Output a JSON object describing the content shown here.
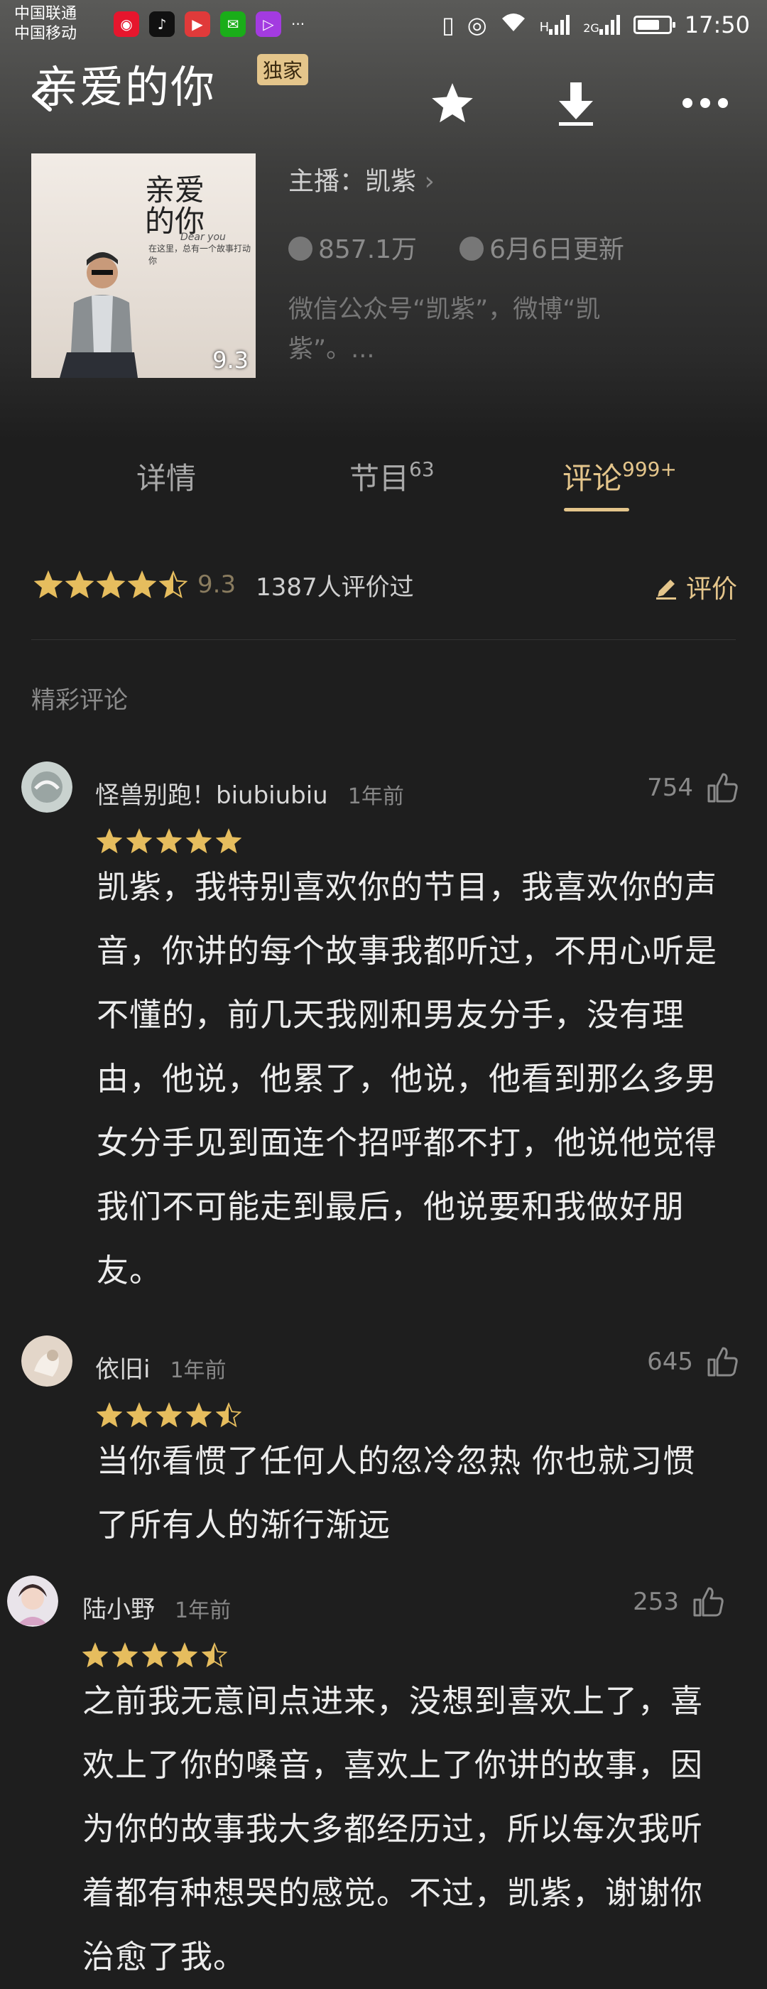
{
  "status_bar": {
    "carrier1": "中国联通",
    "carrier2": "中国移动",
    "signal1": "H",
    "signal2": "2G",
    "more": "···",
    "time": "17:50",
    "battery_level": 0.72
  },
  "header": {
    "title": "亲爱的你",
    "badge": "独家"
  },
  "album": {
    "cover_title": "亲爱的你",
    "cover_subtitle": "在这里，总有一个故事打动你",
    "cover_en": "Dear you",
    "cover_score": "9.3",
    "host_label": "主播：凯紫",
    "plays": "857.1万",
    "updated": "6月6日更新",
    "description": "微信公众号“凯紫”，微博“凯紫”。..."
  },
  "tabs": [
    {
      "label": "详情",
      "count": ""
    },
    {
      "label": "节目",
      "count": "63"
    },
    {
      "label": "评论",
      "count": "999+"
    }
  ],
  "rating": {
    "stars": 4.5,
    "score": "9.3",
    "count_text": "1387人评价过",
    "review_label": "评价"
  },
  "section_title": "精彩评论",
  "comments": [
    {
      "user": "怪兽别跑！biubiubiu",
      "time": "1年前",
      "likes": "754",
      "stars": 5,
      "text": "凯紫，我特别喜欢你的节目，我喜欢你的声音，你讲的每个故事我都听过，不用心听是不懂的，前几天我刚和男友分手，没有理由，他说，他累了，他说，他看到那么多男女分手见到面连个招呼都不打，他说他觉得我们不可能走到最后，他说要和我做好朋友。"
    },
    {
      "user": "依旧i",
      "time": "1年前",
      "likes": "645",
      "stars": 4.5,
      "text": "当你看惯了任何人的忽冷忽热 你也就习惯了所有人的渐行渐远"
    },
    {
      "user": "陆小野",
      "time": "1年前",
      "likes": "253",
      "stars": 4.5,
      "text": "之前我无意间点进来，没想到喜欢上了，喜欢上了你的嗓音，喜欢上了你讲的故事，因为你的故事我大多都经历过，所以每次我听着都有种想哭的感觉。不过，凯紫，谢谢你治愈了我。"
    }
  ],
  "colors": {
    "accent": "#e4c58b",
    "star": "#e6bd5e",
    "background": "#1e1e1e"
  }
}
